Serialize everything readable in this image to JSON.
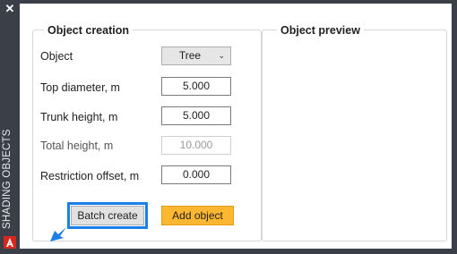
{
  "sidebar": {
    "close_label": "✕",
    "title": "SHADING OBJECTS",
    "logo_icon": "autocad-logo-icon",
    "logo_color": "#d7261e"
  },
  "creation": {
    "title": "Object creation",
    "object": {
      "label": "Object",
      "value": "Tree",
      "options_visible": [
        "Tree"
      ]
    },
    "top_diameter": {
      "label": "Top diameter, m",
      "value": "5.000"
    },
    "trunk_height": {
      "label": "Trunk height, m",
      "value": "5.000"
    },
    "total_height": {
      "label": "Total height, m",
      "value": "10.000",
      "disabled": true
    },
    "restriction_offset": {
      "label": "Restriction offset, m",
      "value": "0.000"
    },
    "batch_button": "Batch create",
    "add_button": "Add object"
  },
  "preview": {
    "title": "Object preview"
  },
  "colors": {
    "highlight": "#1a7fe6",
    "add_button": "#ffb732",
    "sidebar": "#3b4048"
  }
}
